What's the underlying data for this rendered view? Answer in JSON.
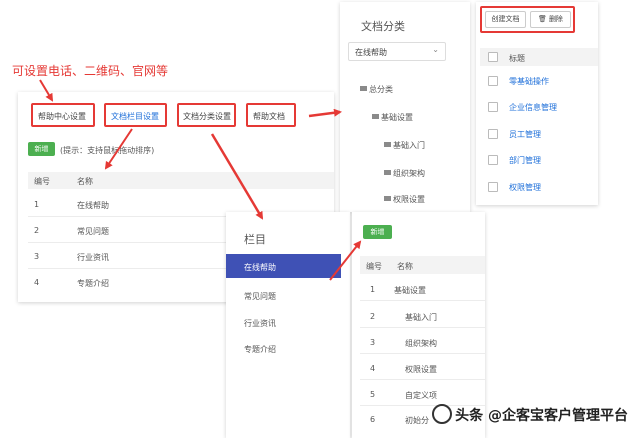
{
  "annotation": {
    "caption": "可设置电话、二维码、官网等"
  },
  "left_panel": {
    "tabs": [
      {
        "label": "帮助中心设置"
      },
      {
        "label": "文档栏目设置"
      },
      {
        "label": "文档分类设置"
      },
      {
        "label": "帮助文档"
      }
    ],
    "add_button": "新增",
    "hint": "(提示：支持鼠标拖动排序)",
    "columns": [
      "编号",
      "名称"
    ],
    "rows": [
      {
        "id": "1",
        "name": "在线帮助"
      },
      {
        "id": "2",
        "name": "常见问题"
      },
      {
        "id": "3",
        "name": "行业资讯"
      },
      {
        "id": "4",
        "name": "专题介绍"
      }
    ]
  },
  "category_panel": {
    "title": "文档分类",
    "select_value": "在线帮助",
    "tree": [
      "总分类",
      "基础设置",
      "基础入门",
      "组织架构",
      "权限设置"
    ]
  },
  "doc_panel": {
    "create_button": "创建文档",
    "delete_button": "删除",
    "column": "标题",
    "items": [
      "零基础操作",
      "企业信息管理",
      "员工管理",
      "部门管理",
      "权限管理"
    ]
  },
  "column_panel": {
    "title": "栏目",
    "items": [
      "在线帮助",
      "常见问题",
      "行业资讯",
      "专题介绍"
    ],
    "active_index": 0
  },
  "list_panel": {
    "add_button": "新增",
    "columns": [
      "编号",
      "名称"
    ],
    "rows": [
      {
        "id": "1",
        "name": "基础设置"
      },
      {
        "id": "2",
        "name": "基础入门"
      },
      {
        "id": "3",
        "name": "组织架构"
      },
      {
        "id": "4",
        "name": "权限设置"
      },
      {
        "id": "5",
        "name": "自定义项"
      },
      {
        "id": "6",
        "name": "初始分"
      }
    ]
  },
  "watermark": {
    "text": "头条 @企客宝客户管理平台"
  },
  "colors": {
    "accent_red": "#e53935",
    "link_blue": "#1e6fd9",
    "green": "#4caf50",
    "active_nav": "#3f51b5"
  }
}
